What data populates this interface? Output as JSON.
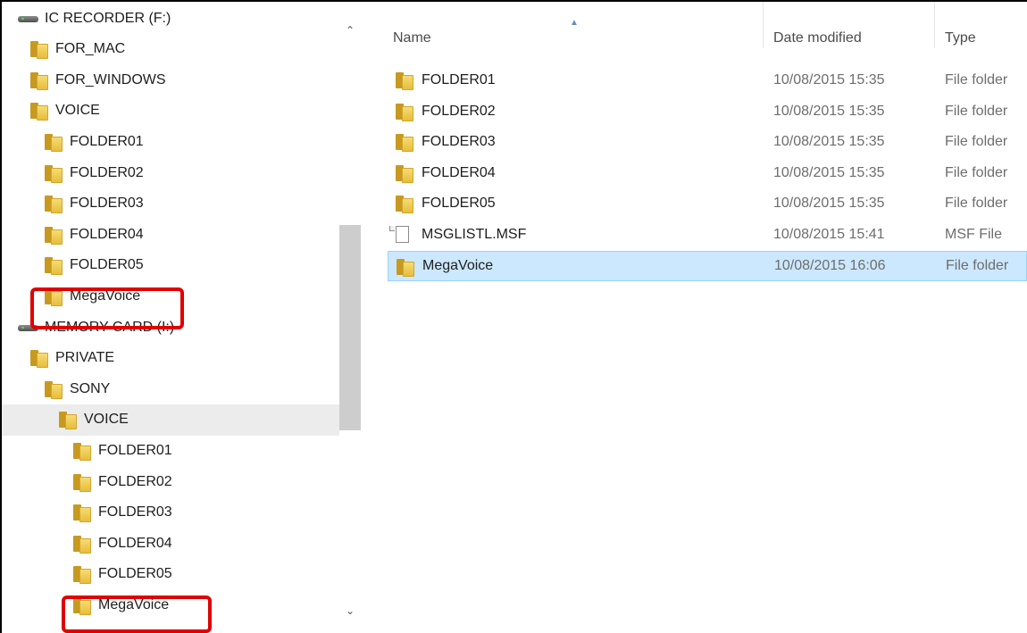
{
  "nav": {
    "items": [
      {
        "label": "IC RECORDER (F:)",
        "kind": "drive",
        "icon": "drive-icon",
        "indent": 0,
        "selected": false
      },
      {
        "label": "FOR_MAC",
        "kind": "folder",
        "icon": "folder-icon",
        "indent": 1,
        "selected": false
      },
      {
        "label": "FOR_WINDOWS",
        "kind": "folder",
        "icon": "folder-icon",
        "indent": 1,
        "selected": false
      },
      {
        "label": "VOICE",
        "kind": "folder",
        "icon": "folder-icon",
        "indent": 1,
        "selected": false
      },
      {
        "label": "FOLDER01",
        "kind": "folder",
        "icon": "folder-icon",
        "indent": 2,
        "selected": false
      },
      {
        "label": "FOLDER02",
        "kind": "folder",
        "icon": "folder-icon",
        "indent": 2,
        "selected": false
      },
      {
        "label": "FOLDER03",
        "kind": "folder",
        "icon": "folder-icon",
        "indent": 2,
        "selected": false
      },
      {
        "label": "FOLDER04",
        "kind": "folder",
        "icon": "folder-icon",
        "indent": 2,
        "selected": false
      },
      {
        "label": "FOLDER05",
        "kind": "folder",
        "icon": "folder-icon",
        "indent": 2,
        "selected": false
      },
      {
        "label": "MegaVoice",
        "kind": "folder",
        "icon": "folder-icon",
        "indent": 2,
        "selected": false,
        "highlighted": true
      },
      {
        "label": "MEMORY CARD (I:)",
        "kind": "drive",
        "icon": "drive-icon",
        "indent": 0,
        "selected": false
      },
      {
        "label": "PRIVATE",
        "kind": "folder",
        "icon": "folder-icon",
        "indent": 1,
        "selected": false
      },
      {
        "label": "SONY",
        "kind": "folder",
        "icon": "folder-icon",
        "indent": 2,
        "selected": false
      },
      {
        "label": "VOICE",
        "kind": "folder",
        "icon": "folder-icon",
        "indent": 3,
        "selected": true
      },
      {
        "label": "FOLDER01",
        "kind": "folder",
        "icon": "folder-icon",
        "indent": 4,
        "selected": false
      },
      {
        "label": "FOLDER02",
        "kind": "folder",
        "icon": "folder-icon",
        "indent": 4,
        "selected": false
      },
      {
        "label": "FOLDER03",
        "kind": "folder",
        "icon": "folder-icon",
        "indent": 4,
        "selected": false
      },
      {
        "label": "FOLDER04",
        "kind": "folder",
        "icon": "folder-icon",
        "indent": 4,
        "selected": false
      },
      {
        "label": "FOLDER05",
        "kind": "folder",
        "icon": "folder-icon",
        "indent": 4,
        "selected": false
      },
      {
        "label": "MegaVoice",
        "kind": "folder",
        "icon": "folder-icon",
        "indent": 4,
        "selected": false,
        "highlighted": true
      }
    ],
    "scroll_up_icon": "chevron-up-icon",
    "scroll_down_icon": "chevron-down-icon"
  },
  "content": {
    "columns": {
      "name": "Name",
      "date_modified": "Date modified",
      "type": "Type"
    },
    "sort_indicator_icon": "sort-up-icon",
    "files": [
      {
        "name": "FOLDER01",
        "date": "10/08/2015 15:35",
        "type": "File folder",
        "icon": "folder-icon",
        "selected": false
      },
      {
        "name": "FOLDER02",
        "date": "10/08/2015 15:35",
        "type": "File folder",
        "icon": "folder-icon",
        "selected": false
      },
      {
        "name": "FOLDER03",
        "date": "10/08/2015 15:35",
        "type": "File folder",
        "icon": "folder-icon",
        "selected": false
      },
      {
        "name": "FOLDER04",
        "date": "10/08/2015 15:35",
        "type": "File folder",
        "icon": "folder-icon",
        "selected": false
      },
      {
        "name": "FOLDER05",
        "date": "10/08/2015 15:35",
        "type": "File folder",
        "icon": "folder-icon",
        "selected": false
      },
      {
        "name": "MSGLISTL.MSF",
        "date": "10/08/2015 15:41",
        "type": "MSF File",
        "icon": "document-icon",
        "selected": false
      },
      {
        "name": "MegaVoice",
        "date": "10/08/2015 16:06",
        "type": "File folder",
        "icon": "folder-icon",
        "selected": true
      }
    ]
  },
  "colors": {
    "highlight_box": "#e00000",
    "selected_row_bg": "#cce8ff",
    "nav_selected_bg": "#ececec",
    "folder_yellow": "#e7bd3d"
  }
}
